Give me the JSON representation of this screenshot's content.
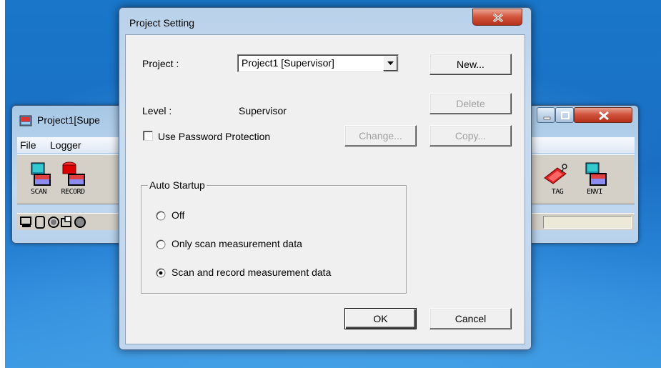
{
  "app": {
    "title": "Project1[Supe",
    "menus": [
      "File",
      "Logger"
    ],
    "toolbar": [
      "SCAN",
      "RECORD",
      "TAG",
      "ENVI"
    ]
  },
  "dialog": {
    "title": "Project Setting",
    "project_label": "Project  :",
    "project_value": "Project1 [Supervisor]",
    "level_label": "Level   :",
    "level_value": "Supervisor",
    "use_password_label": "Use Password Protection",
    "use_password_checked": false,
    "buttons": {
      "new": "New...",
      "delete": "Delete",
      "change": "Change...",
      "copy": "Copy...",
      "ok": "OK",
      "cancel": "Cancel"
    },
    "auto_startup": {
      "title": "Auto Startup",
      "options": [
        "Off",
        "Only scan measurement data",
        "Scan and record measurement data"
      ],
      "selected": "Scan and record measurement data"
    }
  },
  "colors": {
    "desktop": "#1a6fc4",
    "close_button": "#c8432a",
    "dialog_frame": "#c0d6ee",
    "dialog_body": "#f0f0f0"
  }
}
